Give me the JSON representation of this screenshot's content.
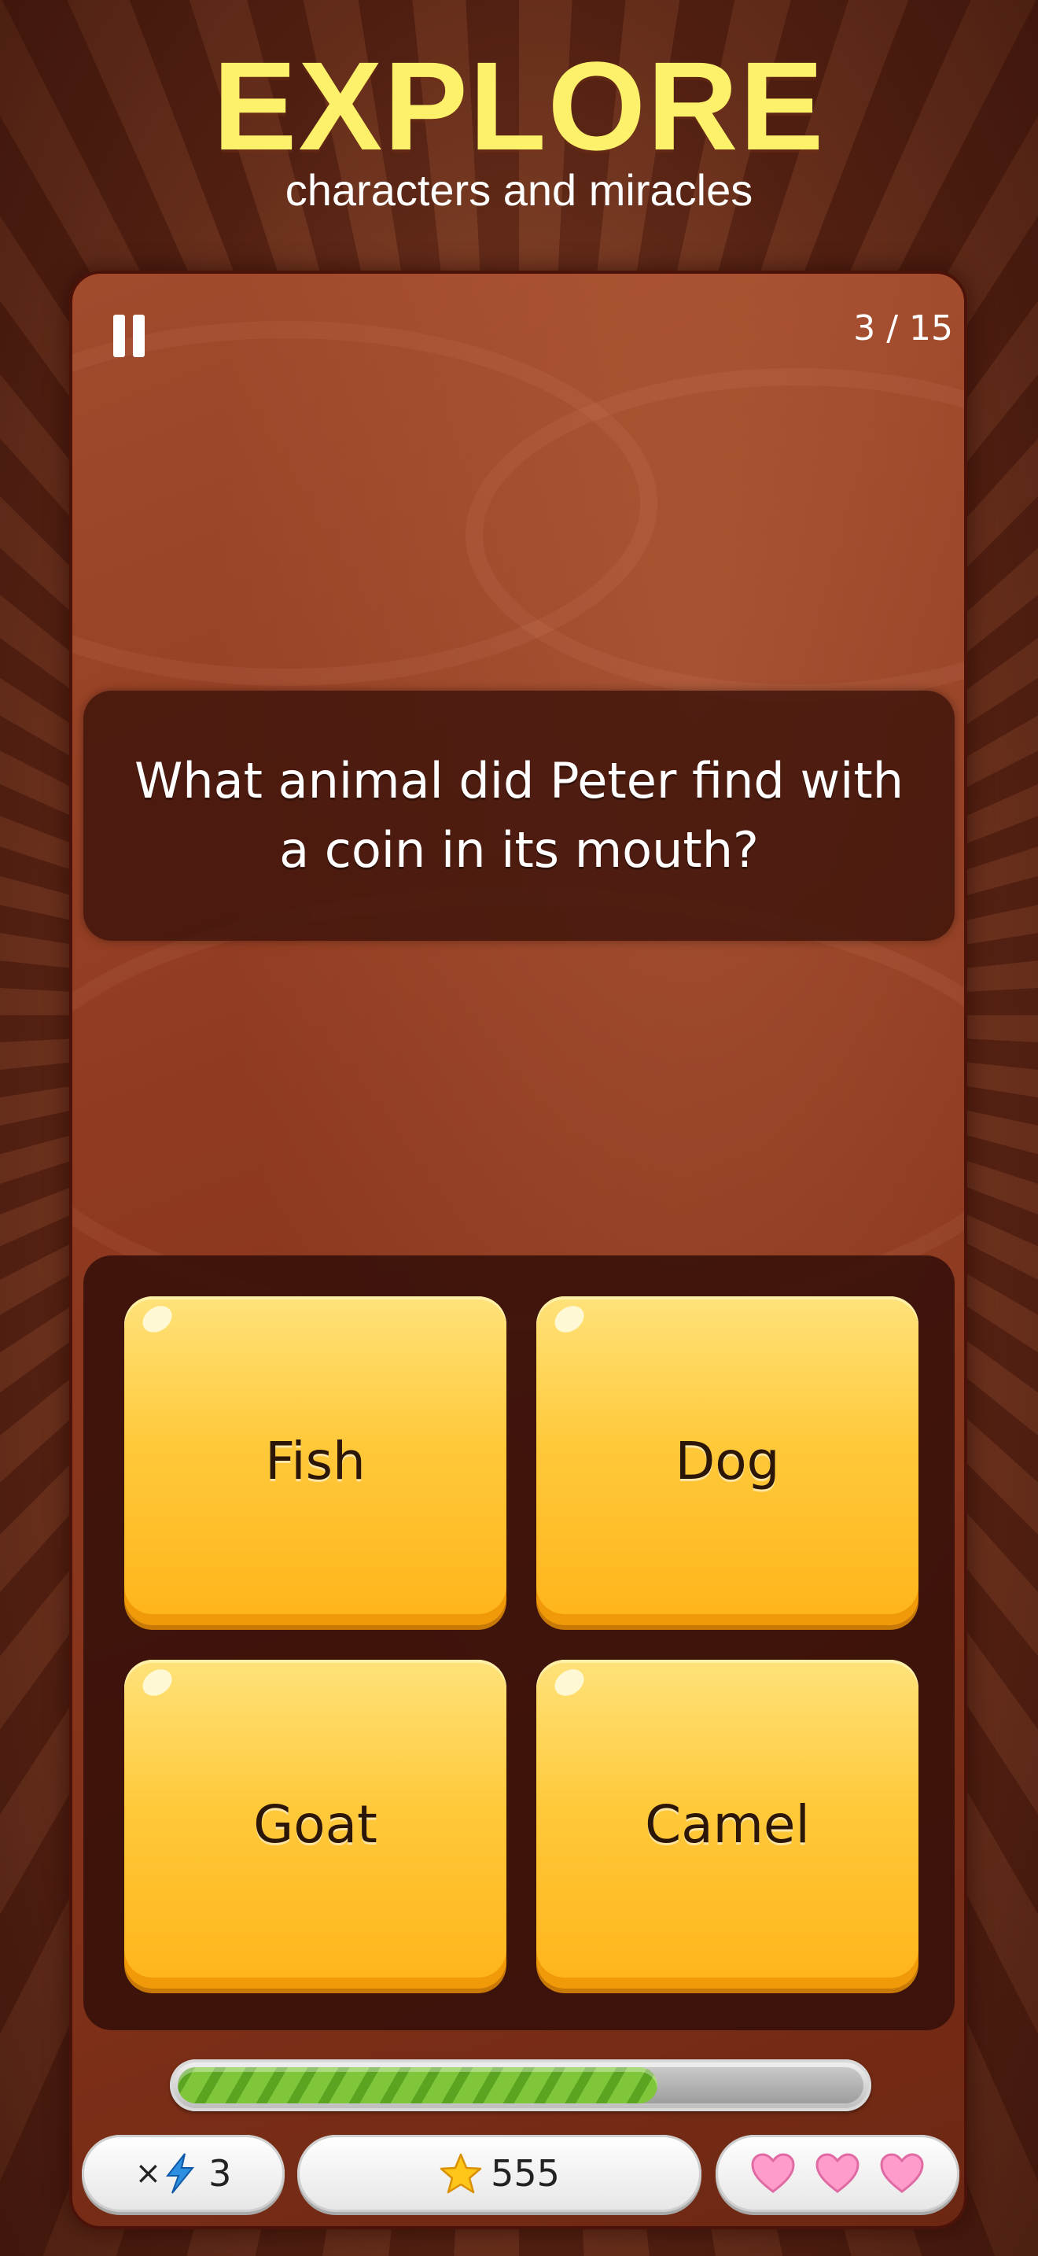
{
  "header": {
    "title": "EXPLORE",
    "subtitle": "characters and miracles"
  },
  "quiz": {
    "progress": "3 / 15",
    "question": "What animal did Peter find with a coin in its mouth?",
    "answers": [
      "Fish",
      "Dog",
      "Goat",
      "Camel"
    ],
    "timer_fraction": 0.7
  },
  "status": {
    "multiplier_prefix": "×",
    "multiplier_icon": "lightning-icon",
    "multiplier_value": "3",
    "star_icon": "star-icon",
    "score": "555",
    "lives": 3,
    "heart_icon": "heart-icon"
  },
  "colors": {
    "title": "#fdf06a",
    "answer_button": "#ffc93a",
    "timer_fill": "#7fc63a",
    "heart": "#ff8fc4"
  }
}
